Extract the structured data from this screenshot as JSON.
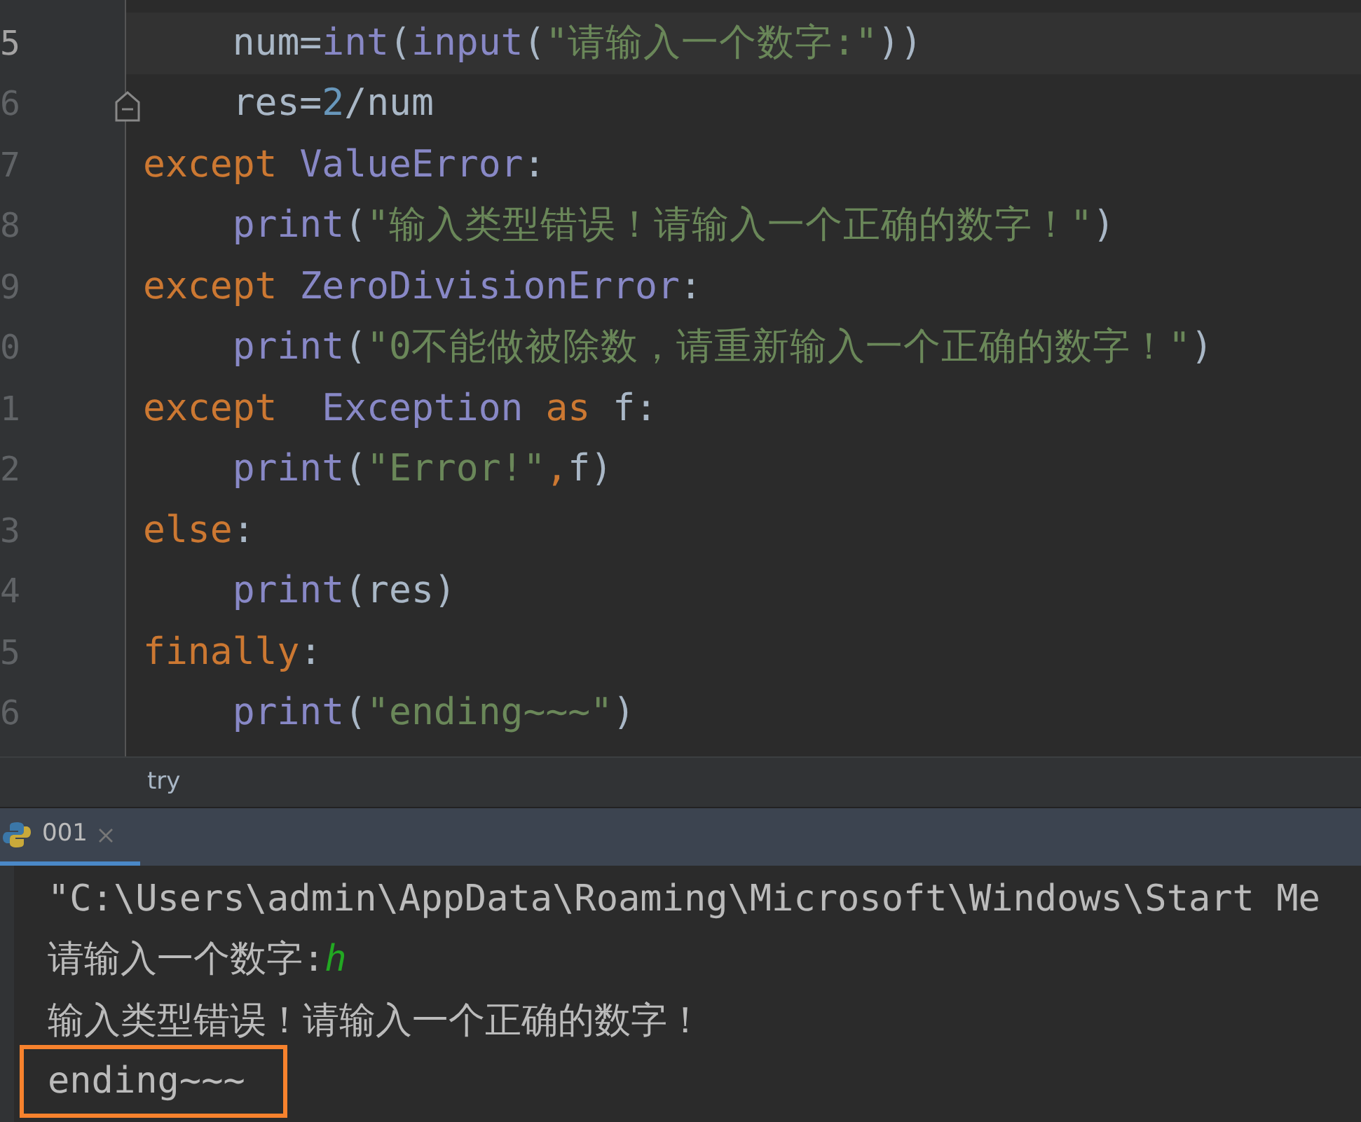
{
  "editor": {
    "lines": [
      {
        "number": "5",
        "current": true,
        "segments": [
          {
            "kind": "plain",
            "text": "    num="
          },
          {
            "kind": "builtin",
            "text": "int"
          },
          {
            "kind": "plain",
            "text": "("
          },
          {
            "kind": "builtin",
            "text": "input"
          },
          {
            "kind": "plain",
            "text": "("
          },
          {
            "kind": "string",
            "text": "\"请输入一个数字:\""
          },
          {
            "kind": "plain",
            "text": "))"
          }
        ]
      },
      {
        "number": "6",
        "current": false,
        "segments": [
          {
            "kind": "plain",
            "text": "    res="
          },
          {
            "kind": "number",
            "text": "2"
          },
          {
            "kind": "plain",
            "text": "/num"
          }
        ]
      },
      {
        "number": "7",
        "current": false,
        "segments": [
          {
            "kind": "keyword",
            "text": "except "
          },
          {
            "kind": "builtin",
            "text": "ValueError"
          },
          {
            "kind": "plain",
            "text": ":"
          }
        ]
      },
      {
        "number": "8",
        "current": false,
        "segments": [
          {
            "kind": "builtin",
            "text": "    print"
          },
          {
            "kind": "plain",
            "text": "("
          },
          {
            "kind": "string",
            "text": "\"输入类型错误！请输入一个正确的数字！\""
          },
          {
            "kind": "plain",
            "text": ")"
          }
        ]
      },
      {
        "number": "9",
        "current": false,
        "segments": [
          {
            "kind": "keyword",
            "text": "except "
          },
          {
            "kind": "builtin",
            "text": "ZeroDivisionError"
          },
          {
            "kind": "plain",
            "text": ":"
          }
        ]
      },
      {
        "number": "0",
        "current": false,
        "segments": [
          {
            "kind": "builtin",
            "text": "    print"
          },
          {
            "kind": "plain",
            "text": "("
          },
          {
            "kind": "string",
            "text": "\"0不能做被除数，请重新输入一个正确的数字！\""
          },
          {
            "kind": "plain",
            "text": ")"
          }
        ]
      },
      {
        "number": "1",
        "current": false,
        "segments": [
          {
            "kind": "keyword",
            "text": "except  "
          },
          {
            "kind": "builtin",
            "text": "Exception "
          },
          {
            "kind": "keyword",
            "text": "as "
          },
          {
            "kind": "plain",
            "text": "f:"
          }
        ]
      },
      {
        "number": "2",
        "current": false,
        "segments": [
          {
            "kind": "builtin",
            "text": "    print"
          },
          {
            "kind": "plain",
            "text": "("
          },
          {
            "kind": "string",
            "text": "\"Error!\""
          },
          {
            "kind": "keyword",
            "text": ","
          },
          {
            "kind": "plain",
            "text": "f)"
          }
        ]
      },
      {
        "number": "3",
        "current": false,
        "segments": [
          {
            "kind": "keyword",
            "text": "else"
          },
          {
            "kind": "plain",
            "text": ":"
          }
        ]
      },
      {
        "number": "4",
        "current": false,
        "segments": [
          {
            "kind": "builtin",
            "text": "    print"
          },
          {
            "kind": "plain",
            "text": "(res)"
          }
        ]
      },
      {
        "number": "5",
        "current": false,
        "segments": [
          {
            "kind": "keyword",
            "text": "finally"
          },
          {
            "kind": "plain",
            "text": ":"
          }
        ]
      },
      {
        "number": "6",
        "current": false,
        "segments": [
          {
            "kind": "builtin",
            "text": "    print"
          },
          {
            "kind": "plain",
            "text": "("
          },
          {
            "kind": "string",
            "text": "\"ending~~~\""
          },
          {
            "kind": "plain",
            "text": ")"
          }
        ]
      }
    ]
  },
  "breadcrumb": "try",
  "run_tabs": [
    {
      "label": "001",
      "selected": true
    }
  ],
  "console": {
    "lines": [
      {
        "highlighted": false,
        "segments": [
          {
            "kind": "output",
            "text": "\"C:\\Users\\admin\\AppData\\Roaming\\Microsoft\\Windows\\Start Me"
          }
        ]
      },
      {
        "highlighted": false,
        "segments": [
          {
            "kind": "output",
            "text": "请输入一个数字:"
          },
          {
            "kind": "input",
            "text": "h"
          }
        ]
      },
      {
        "highlighted": false,
        "segments": [
          {
            "kind": "output",
            "text": "输入类型错误！请输入一个正确的数字！"
          }
        ]
      },
      {
        "highlighted": true,
        "segments": [
          {
            "kind": "output",
            "text": "ending~~~"
          }
        ]
      }
    ]
  }
}
